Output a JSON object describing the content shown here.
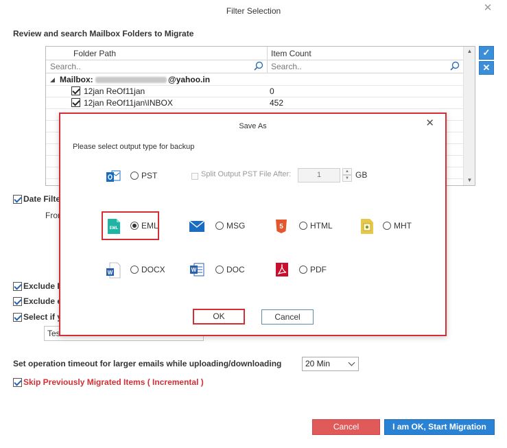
{
  "window": {
    "title": "Filter Selection"
  },
  "review": {
    "title": "Review and search Mailbox Folders to Migrate",
    "columns": {
      "folder_path": "Folder Path",
      "item_count": "Item Count"
    },
    "search_placeholder": "Search..",
    "mailbox_prefix": "Mailbox:",
    "mailbox_suffix": "@yahoo.in",
    "rows": [
      {
        "name": "12jan ReOf11jan",
        "count": "0"
      },
      {
        "name": "12jan ReOf11jan\\INBOX",
        "count": "452"
      }
    ]
  },
  "filters": {
    "date_filter": "Date Filter",
    "from": "From",
    "exclude_1": "Exclude D",
    "exclude_2": "Exclude er",
    "select_if": "Select if yo",
    "text_value": "Tes"
  },
  "timeout": {
    "label": "Set operation timeout for larger emails while uploading/downloading",
    "value": "20 Min"
  },
  "skip_label": "Skip Previously Migrated Items ( Incremental )",
  "buttons": {
    "cancel": "Cancel",
    "start": "I am OK, Start Migration"
  },
  "save_as": {
    "title": "Save As",
    "prompt": "Please select output type for backup",
    "split_label": "Split Output PST File After:",
    "split_value": "1",
    "split_unit": "GB",
    "options": {
      "pst": "PST",
      "eml": "EML",
      "msg": "MSG",
      "html": "HTML",
      "mht": "MHT",
      "docx": "DOCX",
      "doc": "DOC",
      "pdf": "PDF"
    },
    "selected": "EML",
    "ok": "OK",
    "cancel": "Cancel"
  },
  "colors": {
    "accent": "#2a82d4",
    "highlight": "#d42e35",
    "cancel": "#e05a5a",
    "skip_text": "#d42e35"
  }
}
